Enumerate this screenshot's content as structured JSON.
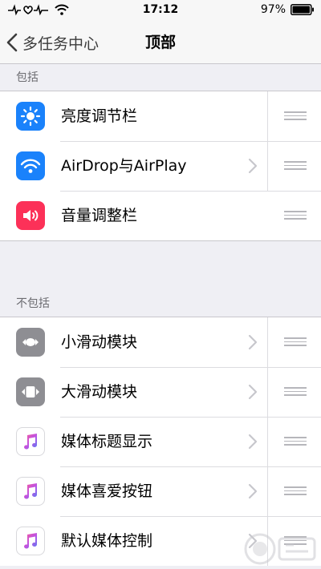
{
  "status_bar": {
    "time": "17:12",
    "battery": "97%",
    "icons": [
      "heartbeat-signal-icon",
      "wifi-icon",
      "battery-icon"
    ]
  },
  "nav": {
    "back_label": "多任务中心",
    "title": "顶部"
  },
  "sections": [
    {
      "header": "包括",
      "rows": [
        {
          "label": "亮度调节栏",
          "icon": "brightness-icon",
          "icon_bg": "#1a82fb",
          "chevron": false
        },
        {
          "label": "AirDrop与AirPlay",
          "icon": "airdrop-icon",
          "icon_bg": "#1a82fb",
          "chevron": true
        },
        {
          "label": "音量调整栏",
          "icon": "volume-icon",
          "icon_bg": "#fc3158",
          "chevron": false
        }
      ]
    },
    {
      "header": "不包括",
      "rows": [
        {
          "label": "小滑动模块",
          "icon": "small-slider-icon",
          "icon_bg": "#8e8e93",
          "chevron": true
        },
        {
          "label": "大滑动模块",
          "icon": "large-slider-icon",
          "icon_bg": "#8e8e93",
          "chevron": true
        },
        {
          "label": "媒体标题显示",
          "icon": "music-note-icon",
          "icon_bg": "#ffffff",
          "chevron": true
        },
        {
          "label": "媒体喜爱按钮",
          "icon": "music-note-icon",
          "icon_bg": "#ffffff",
          "chevron": true
        },
        {
          "label": "默认媒体控制",
          "icon": "music-note-icon",
          "icon_bg": "#ffffff",
          "chevron": true
        }
      ]
    }
  ],
  "colors": {
    "background": "#efeff4",
    "separator": "#c8c7cc",
    "header_text": "#6d6d72",
    "handle": "#b6b6bb"
  }
}
